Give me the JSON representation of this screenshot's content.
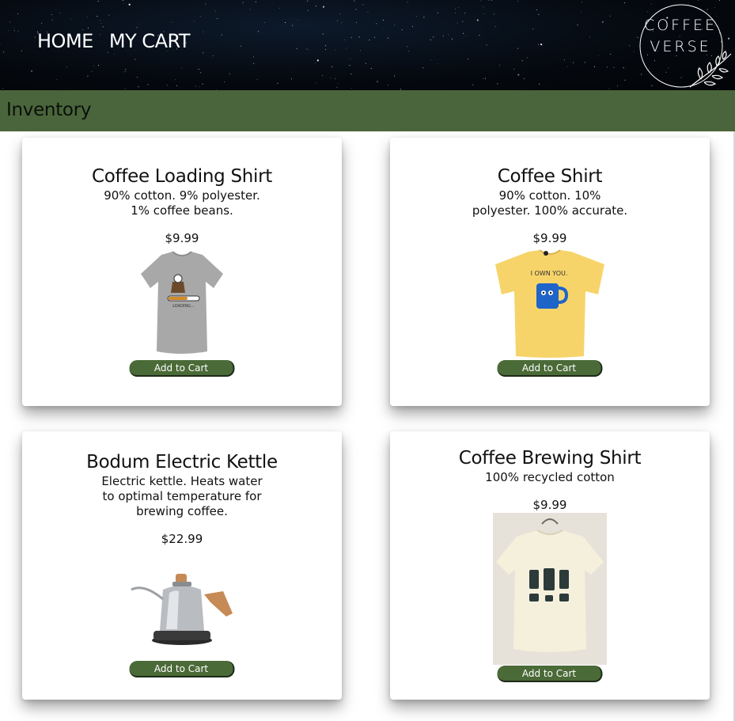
{
  "nav": {
    "home": "HOME",
    "cart": "MY CART"
  },
  "logo": {
    "line1": "COFFEE",
    "line2": "VERSE"
  },
  "page_title": "Inventory",
  "products": [
    {
      "name": "Coffee Loading Shirt",
      "description": [
        "90% cotton. 9% polyester.",
        "1% coffee beans."
      ],
      "price": "$9.99",
      "shirt_text": "LOADING...",
      "button": "Add to Cart"
    },
    {
      "name": "Coffee Shirt",
      "description": [
        "90% cotton. 10%",
        "polyester. 100% accurate."
      ],
      "price": "$9.99",
      "shirt_text": "I OWN YOU.",
      "button": "Add to Cart"
    },
    {
      "name": "Bodum Electric Kettle",
      "description": [
        "Electric kettle. Heats water",
        "to optimal temperature for",
        "brewing coffee."
      ],
      "price": "$22.99",
      "button": "Add to Cart"
    },
    {
      "name": "Coffee Brewing Shirt",
      "description": [
        "100% recycled cotton"
      ],
      "price": "$9.99",
      "button": "Add to Cart"
    }
  ]
}
